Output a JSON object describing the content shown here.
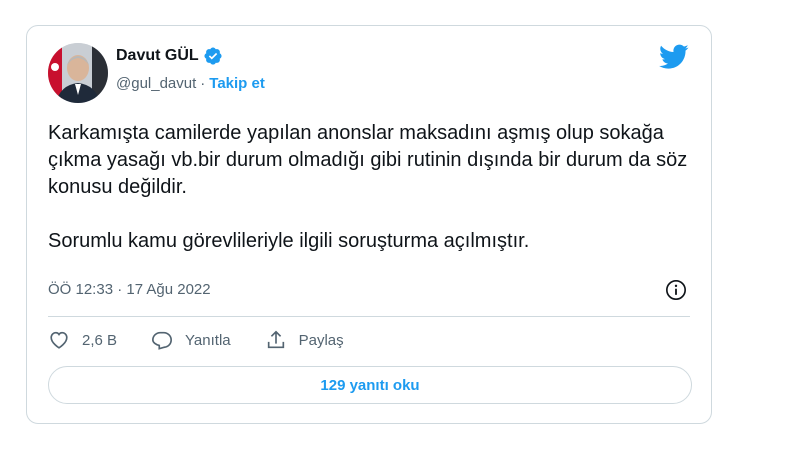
{
  "author": {
    "name": "Davut GÜL",
    "handle": "@gul_davut",
    "separator": "·",
    "follow_label": "Takip et"
  },
  "tweet": {
    "paragraph1": "Karkamışta camilerde yapılan anonslar maksadını aşmış olup sokağa çıkma yasağı vb.bir durum olmadığı gibi rutinin dışında bir durum da söz konusu değildir.",
    "paragraph2": "Sorumlu kamu görevlileriyle ilgili soruşturma açılmıştır.",
    "timestamp": "ÖÖ 12:33 · 17 Ağu 2022"
  },
  "actions": {
    "like_count": "2,6 B",
    "reply_label": "Yanıtla",
    "share_label": "Paylaş"
  },
  "replies_button": "129 yanıtı oku",
  "colors": {
    "accent": "#1d9bf0",
    "secondary_text": "#536471",
    "border": "#cfd9de"
  },
  "icons": [
    "verified-badge-icon",
    "twitter-bird-icon",
    "info-icon",
    "heart-icon",
    "reply-icon",
    "share-icon"
  ]
}
